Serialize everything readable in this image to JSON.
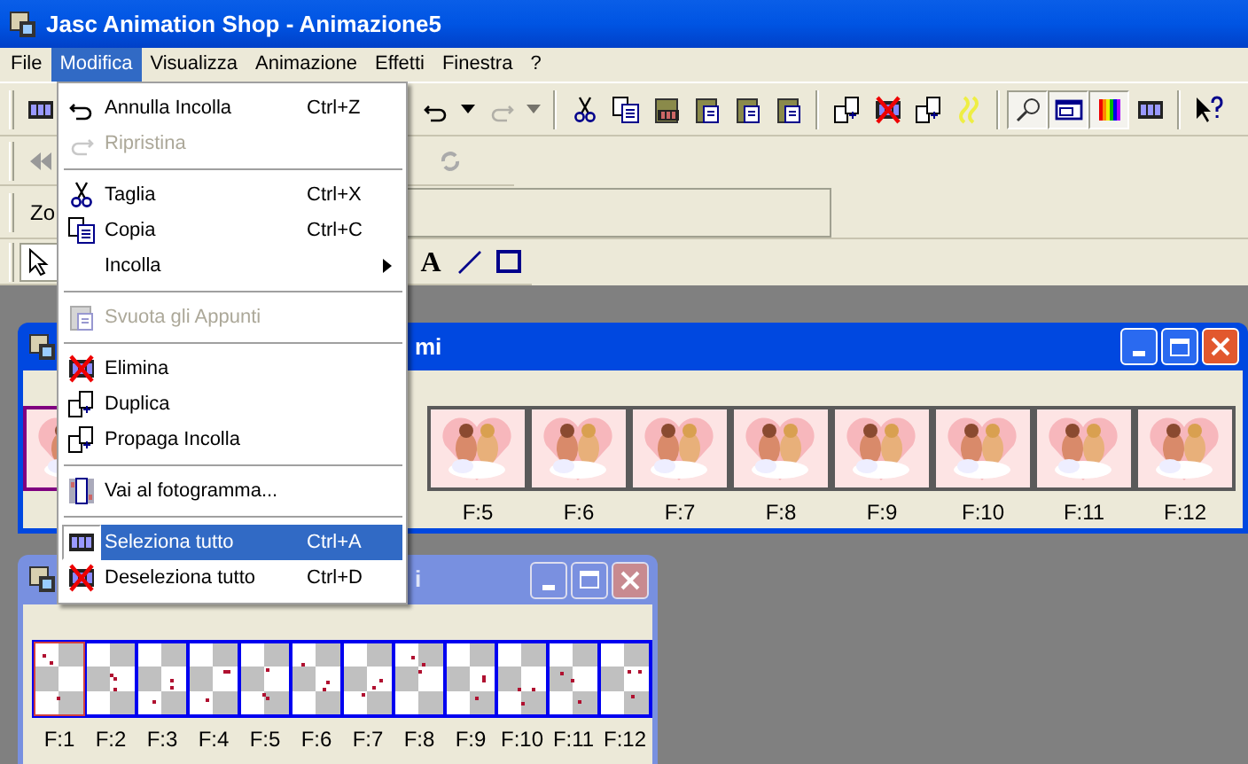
{
  "window": {
    "title": "Jasc Animation Shop - Animazione5"
  },
  "menubar": [
    {
      "label": "File",
      "selected": false
    },
    {
      "label": "Modifica",
      "selected": true
    },
    {
      "label": "Visualizza",
      "selected": false
    },
    {
      "label": "Animazione",
      "selected": false
    },
    {
      "label": "Effetti",
      "selected": false
    },
    {
      "label": "Finestra",
      "selected": false
    },
    {
      "label": "?",
      "selected": false
    }
  ],
  "toolbar_1": [
    {
      "kind": "undo",
      "disabled": false,
      "pressed": false
    },
    {
      "kind": "dropdown",
      "disabled": false,
      "pressed": false
    },
    {
      "kind": "redo",
      "disabled": true,
      "pressed": false
    },
    {
      "kind": "dropdown",
      "disabled": true,
      "pressed": false
    },
    {
      "kind": "separator"
    },
    {
      "kind": "scissors",
      "disabled": false,
      "pressed": false
    },
    {
      "kind": "copy",
      "disabled": false,
      "pressed": false
    },
    {
      "kind": "paste-film",
      "disabled": false,
      "pressed": false
    },
    {
      "kind": "paste",
      "disabled": false,
      "pressed": false
    },
    {
      "kind": "paste",
      "disabled": false,
      "pressed": false
    },
    {
      "kind": "paste",
      "disabled": false,
      "pressed": false
    },
    {
      "kind": "separator"
    },
    {
      "kind": "pages",
      "disabled": false,
      "pressed": false
    },
    {
      "kind": "delete-film",
      "disabled": false,
      "pressed": false
    },
    {
      "kind": "pages",
      "disabled": false,
      "pressed": false
    },
    {
      "kind": "yellow",
      "disabled": false,
      "pressed": false
    },
    {
      "kind": "separator"
    },
    {
      "kind": "magnifier",
      "disabled": false,
      "pressed": true
    },
    {
      "kind": "panel",
      "disabled": false,
      "pressed": true
    },
    {
      "kind": "rainbow",
      "disabled": false,
      "pressed": true
    },
    {
      "kind": "film",
      "disabled": false,
      "pressed": false
    },
    {
      "kind": "separator"
    },
    {
      "kind": "help",
      "disabled": false,
      "pressed": false
    }
  ],
  "toolbar_3": {
    "label": "Zo"
  },
  "toolbar_4": {
    "text_tool": "A"
  },
  "edit_menu": [
    {
      "kind": "item",
      "label": "Annulla Incolla",
      "shortcut": "Ctrl+Z",
      "disabled": false,
      "selected": false
    },
    {
      "kind": "item",
      "label": "Ripristina",
      "disabled": true,
      "selected": false
    },
    {
      "kind": "separator"
    },
    {
      "kind": "item",
      "label": "Taglia",
      "shortcut": "Ctrl+X",
      "disabled": false,
      "selected": false
    },
    {
      "kind": "item",
      "label": "Copia",
      "shortcut": "Ctrl+C",
      "disabled": false,
      "selected": false
    },
    {
      "kind": "submenu",
      "label": "Incolla",
      "disabled": false,
      "selected": false
    },
    {
      "kind": "separator"
    },
    {
      "kind": "item",
      "label": "Svuota gli Appunti",
      "disabled": true,
      "selected": false
    },
    {
      "kind": "separator"
    },
    {
      "kind": "item",
      "label": "Elimina",
      "disabled": false,
      "selected": false
    },
    {
      "kind": "item",
      "label": "Duplica",
      "disabled": false,
      "selected": false
    },
    {
      "kind": "item",
      "label": "Propaga Incolla",
      "disabled": false,
      "selected": false
    },
    {
      "kind": "separator"
    },
    {
      "kind": "item",
      "label": "Vai al fotogramma...",
      "disabled": false,
      "selected": false
    },
    {
      "kind": "separator"
    },
    {
      "kind": "item",
      "label": "Seleziona tutto",
      "shortcut": "Ctrl+A",
      "disabled": false,
      "selected": true
    },
    {
      "kind": "item",
      "label": "Deseleziona tutto",
      "shortcut": "Ctrl+D",
      "disabled": false,
      "selected": false
    }
  ],
  "frame_window_1": {
    "title": "mi",
    "frames": [
      {
        "selected": true
      },
      {
        "label": "F:5",
        "selected": false
      },
      {
        "label": "F:6",
        "selected": false
      },
      {
        "label": "F:7",
        "selected": false
      },
      {
        "label": "F:8",
        "selected": false
      },
      {
        "label": "F:9",
        "selected": false
      },
      {
        "label": "F:10",
        "selected": false
      },
      {
        "label": "F:11",
        "selected": false
      },
      {
        "label": "F:12",
        "selected": false
      }
    ]
  },
  "frame_window_2": {
    "title": "i",
    "frames": [
      {
        "label": "F:1",
        "selected": true
      },
      {
        "label": "F:2",
        "selected": false
      },
      {
        "label": "F:3",
        "selected": false
      },
      {
        "label": "F:4",
        "selected": false
      },
      {
        "label": "F:5",
        "selected": false
      },
      {
        "label": "F:6",
        "selected": false
      },
      {
        "label": "F:7",
        "selected": false
      },
      {
        "label": "F:8",
        "selected": false
      },
      {
        "label": "F:9",
        "selected": false
      },
      {
        "label": "F:10",
        "selected": false
      },
      {
        "label": "F:11",
        "selected": false
      },
      {
        "label": "F:12",
        "selected": false
      }
    ]
  }
}
